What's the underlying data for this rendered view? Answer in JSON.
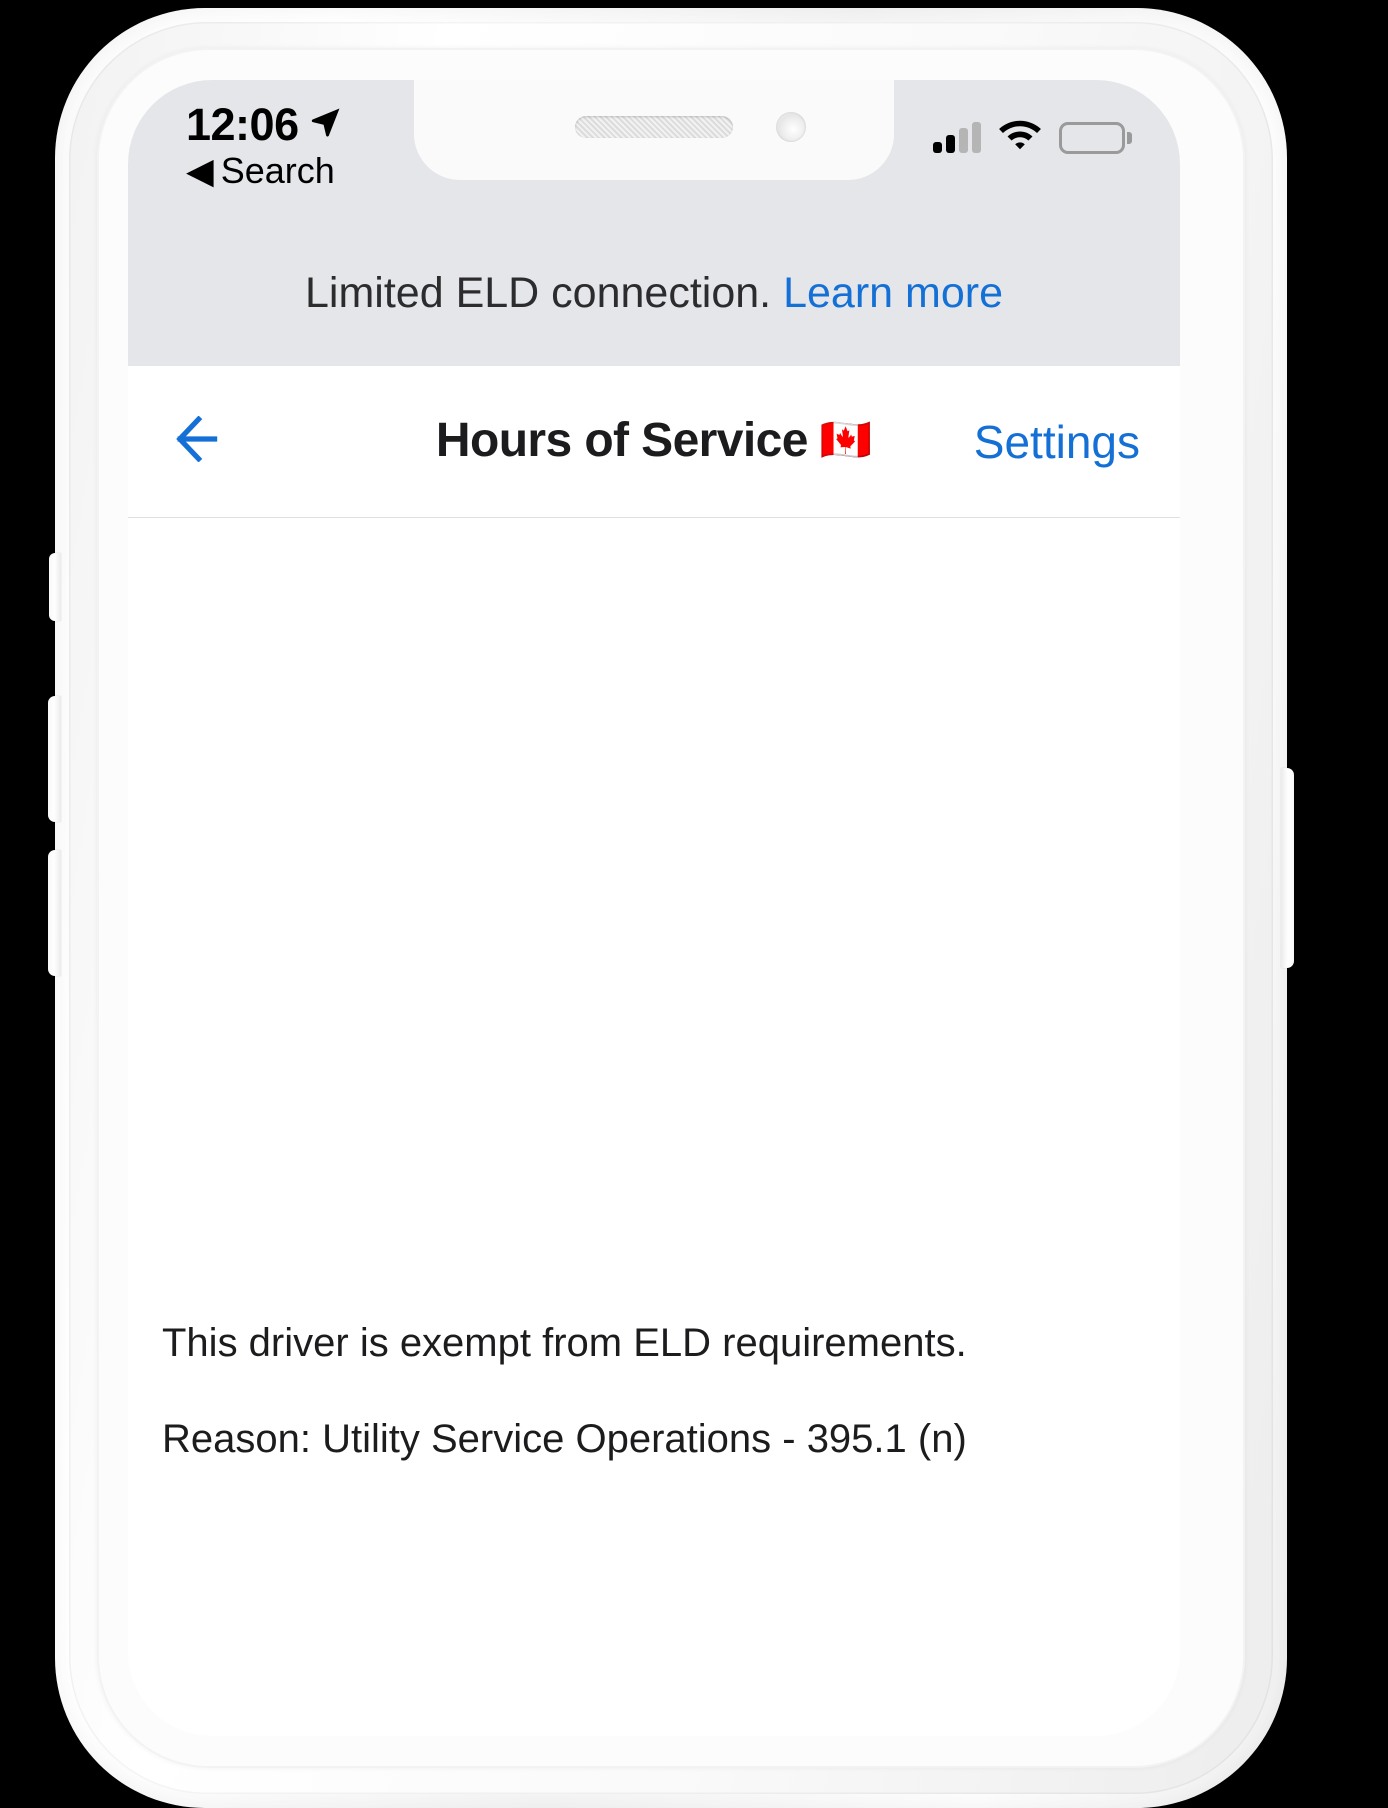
{
  "status_bar": {
    "time": "12:06",
    "location_icon": "location-arrow-icon",
    "back_to_app_label": "Search",
    "back_to_app_caret": "◀",
    "cellular_icon": "cellular-signal-icon",
    "wifi_icon": "wifi-icon",
    "battery_icon": "battery-full-icon"
  },
  "banner": {
    "message": "Limited ELD connection.",
    "link_label": "Learn more",
    "link_color": "#1570d6",
    "background": "#e4e6e9"
  },
  "navbar": {
    "back_icon": "arrow-left-icon",
    "title": "Hours of Service",
    "flag": "🇨🇦",
    "settings_label": "Settings",
    "accent_color": "#1570d6"
  },
  "content": {
    "exempt_message": "This driver is exempt from ELD requirements.",
    "exempt_reason": "Reason: Utility Service Operations - 395.1 (n)"
  }
}
